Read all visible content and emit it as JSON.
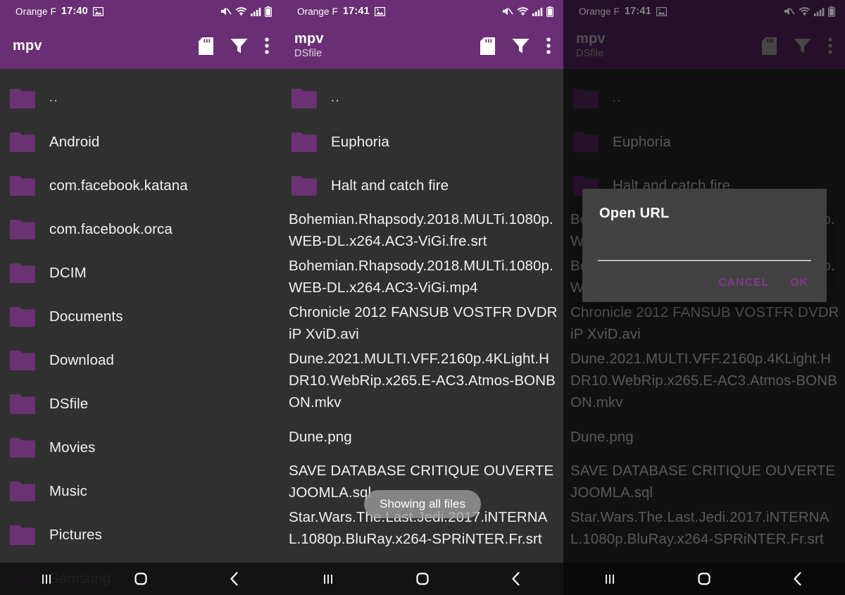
{
  "panels": [
    {
      "id": "panel-1",
      "status": {
        "carrier": "Orange F",
        "time": "17:40",
        "icons": [
          "image-icon",
          "mute-icon",
          "wifi-icon",
          "signal-icon",
          "battery-icon"
        ]
      },
      "toolbar": {
        "title": "mpv",
        "subtitle": "",
        "actions": [
          "sdcard-icon",
          "filter-icon",
          "overflow-menu-icon"
        ]
      },
      "entries": [
        {
          "name": "..",
          "type": "folder"
        },
        {
          "name": "Android",
          "type": "folder"
        },
        {
          "name": "com.facebook.katana",
          "type": "folder"
        },
        {
          "name": "com.facebook.orca",
          "type": "folder"
        },
        {
          "name": "DCIM",
          "type": "folder"
        },
        {
          "name": "Documents",
          "type": "folder"
        },
        {
          "name": "Download",
          "type": "folder"
        },
        {
          "name": "DSfile",
          "type": "folder"
        },
        {
          "name": "Movies",
          "type": "folder"
        },
        {
          "name": "Music",
          "type": "folder"
        },
        {
          "name": "Pictures",
          "type": "folder"
        },
        {
          "name": "Samsung",
          "type": "folder"
        }
      ],
      "toast": null,
      "dialog": null,
      "dimmed": false
    },
    {
      "id": "panel-2",
      "status": {
        "carrier": "Orange F",
        "time": "17:41",
        "icons": [
          "image-icon",
          "mute-icon",
          "wifi-icon",
          "signal-icon",
          "battery-icon"
        ]
      },
      "toolbar": {
        "title": "mpv",
        "subtitle": "DSfile",
        "actions": [
          "sdcard-icon",
          "filter-icon",
          "overflow-menu-icon"
        ]
      },
      "entries": [
        {
          "name": "..",
          "type": "folder"
        },
        {
          "name": "Euphoria",
          "type": "folder"
        },
        {
          "name": "Halt and catch fire",
          "type": "folder"
        },
        {
          "name": "Bohemian.Rhapsody.2018.MULTi.1080p.WEB-DL.x264.AC3-ViGi.fre.srt",
          "type": "file"
        },
        {
          "name": "Bohemian.Rhapsody.2018.MULTi.1080p.WEB-DL.x264.AC3-ViGi.mp4",
          "type": "file"
        },
        {
          "name": "Chronicle 2012 FANSUB VOSTFR DVDRiP XviD.avi",
          "type": "file"
        },
        {
          "name": "Dune.2021.MULTI.VFF.2160p.4KLight.HDR10.WebRip.x265.E-AC3.Atmos-BONBON.mkv",
          "type": "file"
        },
        {
          "name": "Dune.png",
          "type": "file"
        },
        {
          "name": "SAVE DATABASE CRITIQUE OUVERTE JOOMLA.sql",
          "type": "file"
        },
        {
          "name": "Star.Wars.The.Last.Jedi.2017.iNTERNAL.1080p.BluRay.x264-SPRiNTER.Fr.srt",
          "type": "file"
        }
      ],
      "toast": "Showing all files",
      "dialog": null,
      "dimmed": false
    },
    {
      "id": "panel-3",
      "status": {
        "carrier": "Orange F",
        "time": "17:41",
        "icons": [
          "image-icon",
          "mute-icon",
          "wifi-icon",
          "signal-icon",
          "battery-icon"
        ]
      },
      "toolbar": {
        "title": "mpv",
        "subtitle": "DSfile",
        "actions": [
          "sdcard-icon",
          "filter-icon",
          "overflow-menu-icon"
        ]
      },
      "entries": [
        {
          "name": "..",
          "type": "folder"
        },
        {
          "name": "Euphoria",
          "type": "folder"
        },
        {
          "name": "Halt and catch fire",
          "type": "folder"
        },
        {
          "name": "Bohemian.Rhapsody.2018.MULTi.1080p.WEB-DL.x264.AC3-ViGi.fre.srt",
          "type": "file"
        },
        {
          "name": "Bohemian.Rhapsody.2018.MULTi.1080p.WEB-DL.x264.AC3-ViGi.mp4",
          "type": "file"
        },
        {
          "name": "Chronicle 2012 FANSUB VOSTFR DVDRiP XviD.avi",
          "type": "file"
        },
        {
          "name": "Dune.2021.MULTI.VFF.2160p.4KLight.HDR10.WebRip.x265.E-AC3.Atmos-BONBON.mkv",
          "type": "file"
        },
        {
          "name": "Dune.png",
          "type": "file"
        },
        {
          "name": "SAVE DATABASE CRITIQUE OUVERTE JOOMLA.sql",
          "type": "file"
        },
        {
          "name": "Star.Wars.The.Last.Jedi.2017.iNTERNAL.1080p.BluRay.x264-SPRiNTER.Fr.srt",
          "type": "file"
        }
      ],
      "toast": null,
      "dialog": {
        "title": "Open URL",
        "input_value": "",
        "input_placeholder": "",
        "cancel_label": "CANCEL",
        "ok_label": "OK"
      },
      "dimmed": true
    }
  ],
  "navbar": {
    "recents_label": "recents-icon",
    "home_label": "home-icon",
    "back_label": "back-icon"
  },
  "colors": {
    "accent_purple": "#6A2E74",
    "folder_purple": "#6B3273",
    "background_dark": "#303030",
    "background_dim": "#1b1b1b",
    "dialog_bg": "#424242",
    "dialog_button": "#7d3a86",
    "text_primary": "#f2f2f2",
    "text_dim": "#8c8c8c"
  }
}
